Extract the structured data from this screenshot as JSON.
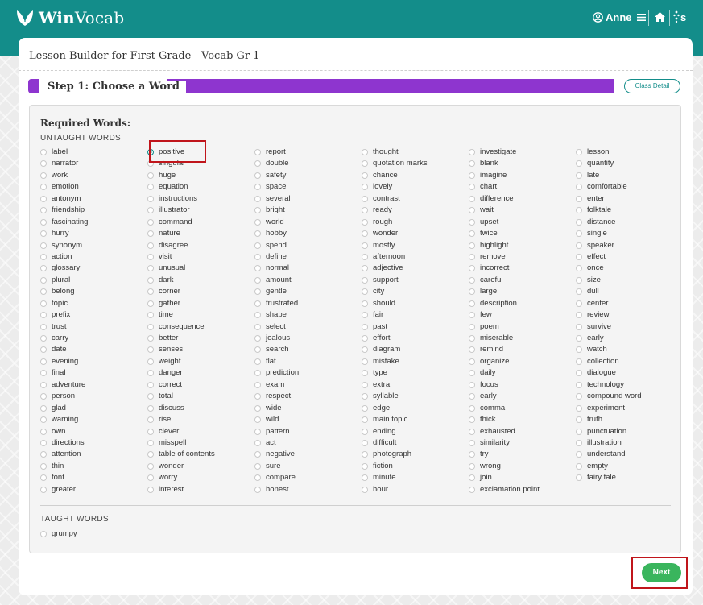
{
  "app": {
    "logo_bold": "Win",
    "logo_rest": "Vocab",
    "user_name": "Anne",
    "brand_badge": "s"
  },
  "page": {
    "title": "Lesson Builder for First Grade - Vocab Gr 1"
  },
  "step": {
    "label": "Step 1: Choose a Word",
    "class_detail_label": "Class Detail"
  },
  "sections": {
    "required_title": "Required Words:",
    "untaught_title": "UNTAUGHT WORDS",
    "taught_title": "TAUGHT WORDS"
  },
  "selected_word": "positive",
  "untaught_columns": [
    [
      "label",
      "narrator",
      "work",
      "emotion",
      "antonym",
      "friendship",
      "fascinating",
      "hurry",
      "synonym",
      "action",
      "glossary",
      "plural",
      "belong",
      "topic",
      "prefix",
      "trust",
      "carry",
      "date",
      "evening",
      "final",
      "adventure",
      "person",
      "glad",
      "warning",
      "own",
      "directions",
      "attention",
      "thin",
      "font",
      "greater"
    ],
    [
      "positive",
      "singular",
      "huge",
      "equation",
      "instructions",
      "illustrator",
      "command",
      "nature",
      "disagree",
      "visit",
      "unusual",
      "dark",
      "corner",
      "gather",
      "time",
      "consequence",
      "better",
      "senses",
      "weight",
      "danger",
      "correct",
      "total",
      "discuss",
      "rise",
      "clever",
      "misspell",
      "table of contents",
      "wonder",
      "worry",
      "interest"
    ],
    [
      "report",
      "double",
      "safety",
      "space",
      "several",
      "bright",
      "world",
      "hobby",
      "spend",
      "define",
      "normal",
      "amount",
      "gentle",
      "frustrated",
      "shape",
      "select",
      "jealous",
      "search",
      "flat",
      "prediction",
      "exam",
      "respect",
      "wide",
      "wild",
      "pattern",
      "act",
      "negative",
      "sure",
      "compare",
      "honest"
    ],
    [
      "thought",
      "quotation marks",
      "chance",
      "lovely",
      "contrast",
      "ready",
      "rough",
      "wonder",
      "mostly",
      "afternoon",
      "adjective",
      "support",
      "city",
      "should",
      "fair",
      "past",
      "effort",
      "diagram",
      "mistake",
      "type",
      "extra",
      "syllable",
      "edge",
      "main topic",
      "ending",
      "difficult",
      "photograph",
      "fiction",
      "minute",
      "hour"
    ],
    [
      "investigate",
      "blank",
      "imagine",
      "chart",
      "difference",
      "wait",
      "upset",
      "twice",
      "highlight",
      "remove",
      "incorrect",
      "careful",
      "large",
      "description",
      "few",
      "poem",
      "miserable",
      "remind",
      "organize",
      "daily",
      "focus",
      "early",
      "comma",
      "thick",
      "exhausted",
      "similarity",
      "try",
      "wrong",
      "join",
      "exclamation point"
    ],
    [
      "lesson",
      "quantity",
      "late",
      "comfortable",
      "enter",
      "folktale",
      "distance",
      "single",
      "speaker",
      "effect",
      "once",
      "size",
      "dull",
      "center",
      "review",
      "survive",
      "early",
      "watch",
      "collection",
      "dialogue",
      "technology",
      "compound word",
      "experiment",
      "truth",
      "punctuation",
      "illustration",
      "understand",
      "empty",
      "fairy tale"
    ]
  ],
  "taught_words": [
    "grumpy"
  ],
  "buttons": {
    "next_label": "Next"
  },
  "colors": {
    "brand_teal": "#138d8a",
    "step_purple": "#8e35cf",
    "next_green": "#3ab55d",
    "highlight_red": "#c0151b"
  }
}
